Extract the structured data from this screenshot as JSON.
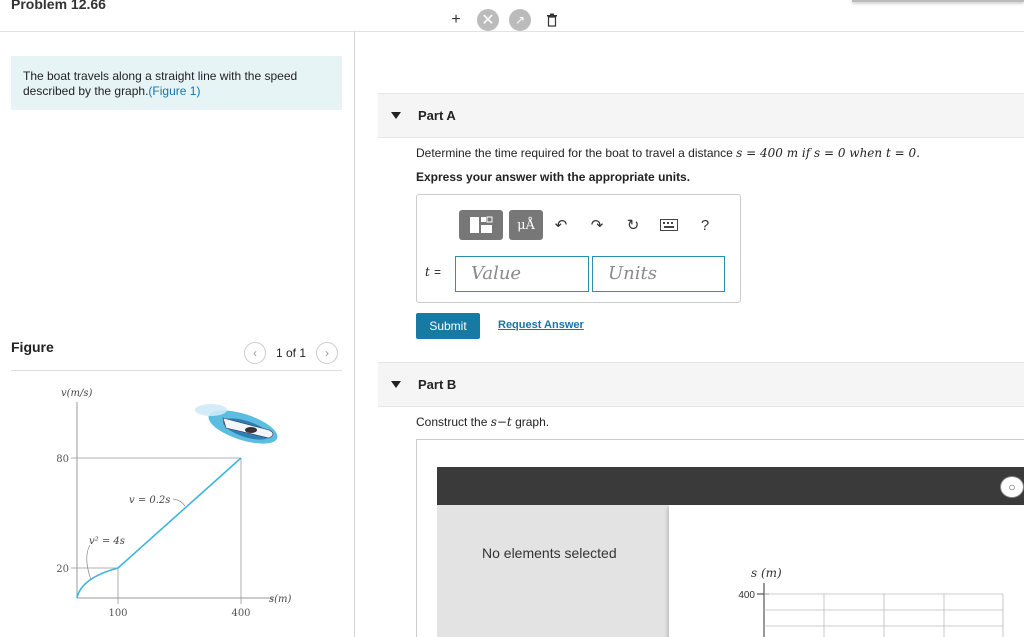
{
  "header": {
    "problem_title": "Problem 12.66"
  },
  "intro": {
    "text": "The boat travels along a straight line with the speed described by the graph.",
    "figure_link": "(Figure 1)"
  },
  "figure": {
    "heading": "Figure",
    "counter": "1 of 1",
    "prev_icon": "chevron-left-icon",
    "next_icon": "chevron-right-icon",
    "y_axis_label": "v(m/s)",
    "x_axis_label": "s(m)",
    "y_ticks": [
      "80",
      "20"
    ],
    "x_ticks": [
      "100",
      "400"
    ],
    "curve_label_1": "v² = 4s",
    "curve_label_2": "v = 0.2s"
  },
  "chart_data": {
    "type": "line",
    "xlabel": "s(m)",
    "ylabel": "v(m/s)",
    "series": [
      {
        "x": [
          0,
          25,
          50,
          75,
          100
        ],
        "y": [
          0,
          10,
          14.1,
          17.3,
          20
        ]
      },
      {
        "x": [
          100,
          400
        ],
        "y": [
          20,
          80
        ]
      }
    ],
    "xlim": [
      0,
      400
    ],
    "ylim": [
      0,
      80
    ],
    "annotations": [
      "v² = 4s",
      "v = 0.2s"
    ]
  },
  "partA": {
    "label": "Part A",
    "question_prefix": "Determine the time required for the boat to travel a distance ",
    "question_math": "s = 400 m if s = 0 when t = 0.",
    "instruction": "Express your answer with the appropriate units.",
    "toolbar": [
      "templates-icon",
      "units-icon",
      "undo-icon",
      "redo-icon",
      "reset-icon",
      "keyboard-icon",
      "help-icon"
    ],
    "mu_label": "μÅ",
    "help_label": "?",
    "var_label": "t",
    "equals": "=",
    "value_placeholder": "Value",
    "units_placeholder": "Units",
    "submit_label": "Submit",
    "request_label": "Request Answer"
  },
  "partB": {
    "label": "Part B",
    "prompt_prefix": "Construct the ",
    "prompt_math": "s−t",
    "prompt_suffix": " graph.",
    "no_selection": "No elements selected",
    "tools": [
      "add-point-icon",
      "draw-line-icon",
      "add-vector-icon",
      "delete-icon"
    ],
    "hint_icon": "lightbulb-icon",
    "canvas_y_label": "s (m)",
    "canvas_tick": "400"
  }
}
